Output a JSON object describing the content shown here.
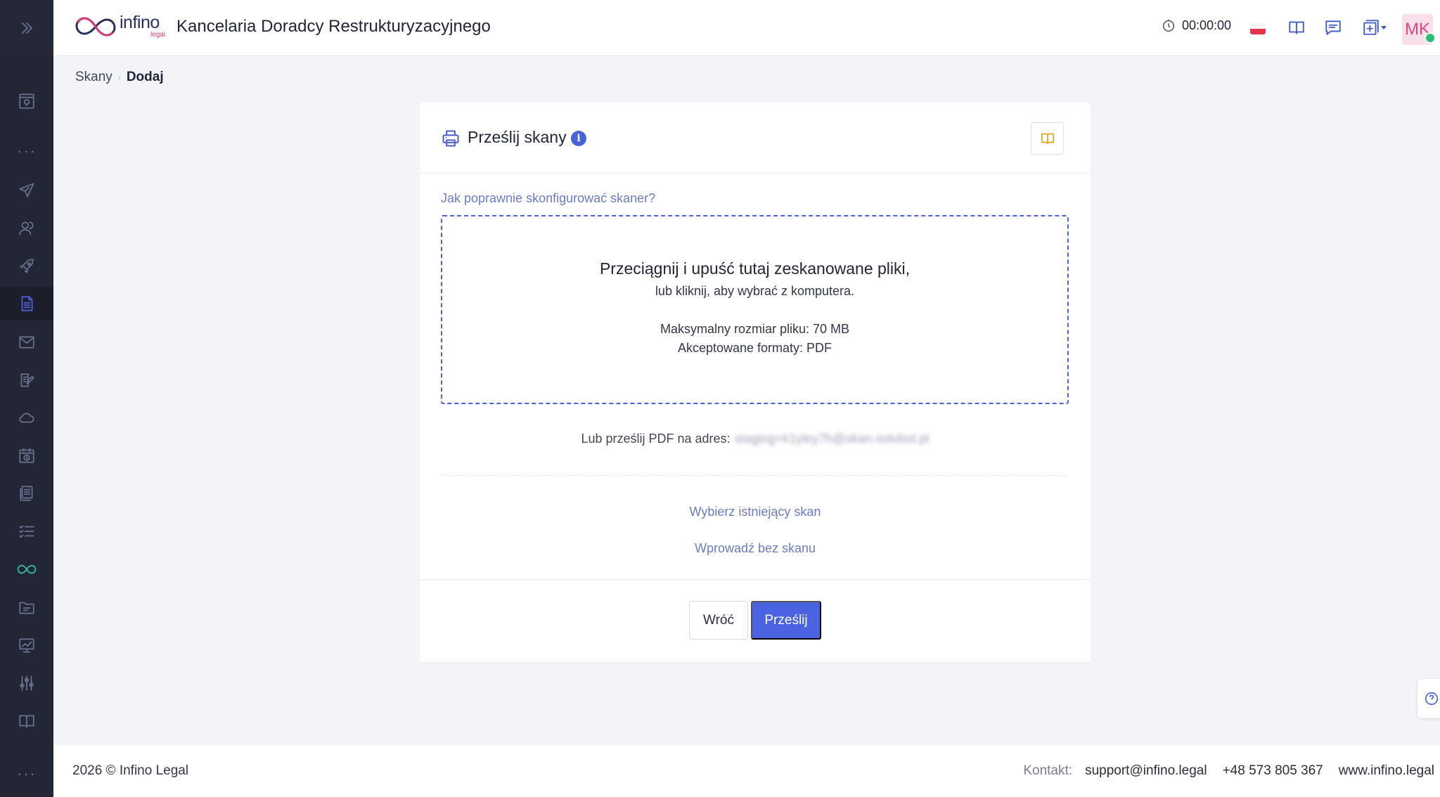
{
  "header": {
    "brand_name": "infino",
    "brand_sub": "legal",
    "app_title": "Kancelaria Doradcy Restrukturyzacyjnego",
    "timer": "00:00:00",
    "avatar_initials": "MK",
    "icons": [
      "timer-icon",
      "flag-pl-icon",
      "book-icon",
      "chat-icon",
      "add-window-icon"
    ]
  },
  "sidebar": {
    "items": [
      {
        "icon": "dashboard-icon"
      },
      {
        "icon": "send-icon"
      },
      {
        "icon": "users-icon"
      },
      {
        "icon": "rocket-icon"
      },
      {
        "icon": "document-icon",
        "active": true
      },
      {
        "icon": "mail-icon"
      },
      {
        "icon": "edit-document-icon"
      },
      {
        "icon": "cloud-icon"
      },
      {
        "icon": "calendar-clock-icon"
      },
      {
        "icon": "database-icon"
      },
      {
        "icon": "checklist-icon"
      },
      {
        "icon": "infinity-icon"
      },
      {
        "icon": "folder-icon"
      },
      {
        "icon": "chart-icon"
      },
      {
        "icon": "sliders-icon"
      },
      {
        "icon": "book-icon"
      }
    ]
  },
  "breadcrumb": {
    "items": [
      "Skany"
    ],
    "current": "Dodaj"
  },
  "card": {
    "title": "Prześlij skany",
    "help_link": "Jak poprawnie skonfigurować skaner?",
    "dropzone": {
      "title": "Przeciągnij i upuść tutaj zeskanowane pliki,",
      "subtitle": "lub kliknij, aby wybrać z komputera.",
      "max_size": "Maksymalny rozmiar pliku: 70 MB",
      "formats": "Akceptowane formaty: PDF"
    },
    "email_label": "Lub prześlij PDF na adres:",
    "email_value": "staging+k1yley7h@skan.solvbot.pl",
    "choose_existing": "Wybierz istniejący skan",
    "without_scan": "Wprowadź bez skanu",
    "back_button": "Wróć",
    "submit_button": "Prześlij"
  },
  "footer": {
    "copyright": "2026 © Infino Legal",
    "contact_label": "Kontakt:",
    "email": "support@infino.legal",
    "phone": "+48 573 805 367",
    "website": "www.infino.legal"
  },
  "colors": {
    "sidebar_bg": "#232634",
    "accent": "#4a63e0",
    "link": "#6d7bc6",
    "brand_pink": "#d53c78"
  }
}
